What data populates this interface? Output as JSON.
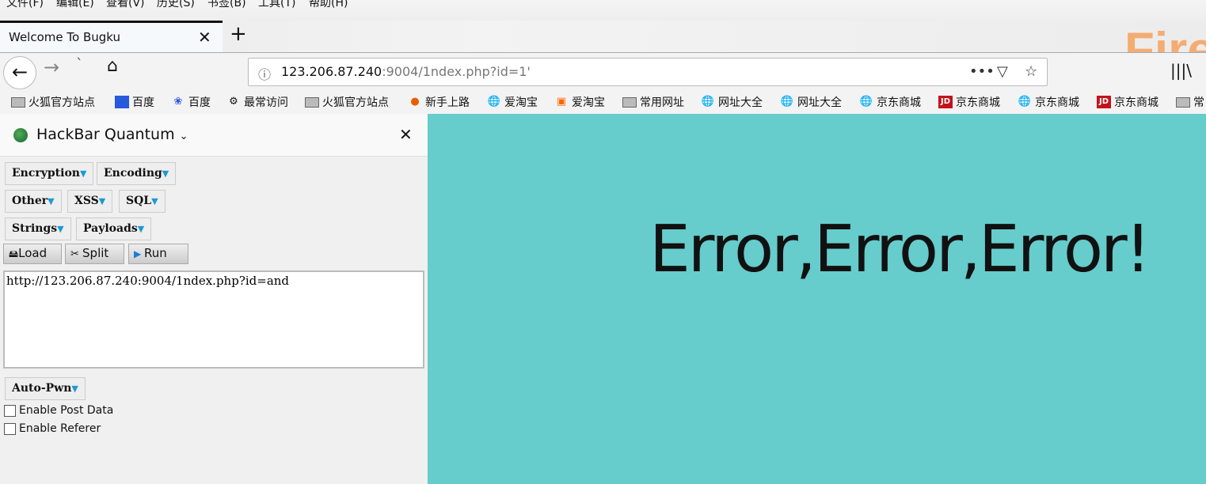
{
  "menu": [
    "文件(F)",
    "编辑(E)",
    "查看(V)",
    "历史(S)",
    "书签(B)",
    "工具(T)",
    "帮助(H)"
  ],
  "tab": {
    "title": "Welcome To Bugku"
  },
  "url": {
    "host": "123.206.87.240",
    "rest": ":9004/1ndex.php?id=1'"
  },
  "bookmarks": [
    {
      "label": "火狐官方站点",
      "icon": "folder-icon"
    },
    {
      "label": "百度",
      "icon": "baidu-paw-icon"
    },
    {
      "label": "百度",
      "icon": "baidu-du-icon"
    },
    {
      "label": "最常访问",
      "icon": "gear-icon"
    },
    {
      "label": "火狐官方站点",
      "icon": "folder-icon"
    },
    {
      "label": "新手上路",
      "icon": "firefox-icon"
    },
    {
      "label": "爱淘宝",
      "icon": "globe-icon"
    },
    {
      "label": "爱淘宝",
      "icon": "taobao-icon"
    },
    {
      "label": "常用网址",
      "icon": "folder-icon"
    },
    {
      "label": "网址大全",
      "icon": "globe-icon"
    },
    {
      "label": "网址大全",
      "icon": "globe-icon"
    },
    {
      "label": "京东商城",
      "icon": "globe-icon"
    },
    {
      "label": "京东商城",
      "icon": "jd-icon"
    },
    {
      "label": "京东商城",
      "icon": "globe-icon"
    },
    {
      "label": "京东商城",
      "icon": "jd-icon"
    },
    {
      "label": "常",
      "icon": "folder-icon"
    }
  ],
  "logo": "Fire",
  "hackbar": {
    "title": "HackBar Quantum",
    "menus": [
      "Encryption",
      "Encoding",
      "Other",
      "XSS",
      "SQL",
      "Strings",
      "Payloads"
    ],
    "load": "Load",
    "split": "Split",
    "run": "Run",
    "url_value": "http://123.206.87.240:9004/1ndex.php?id=and",
    "autopwn": "Auto-Pwn",
    "post_data": "Enable Post Data",
    "post_checked": false,
    "referer": "Enable Referer",
    "referer_checked": false
  },
  "page": {
    "message": "Error,Error,Error!",
    "background": "#66cccc"
  }
}
